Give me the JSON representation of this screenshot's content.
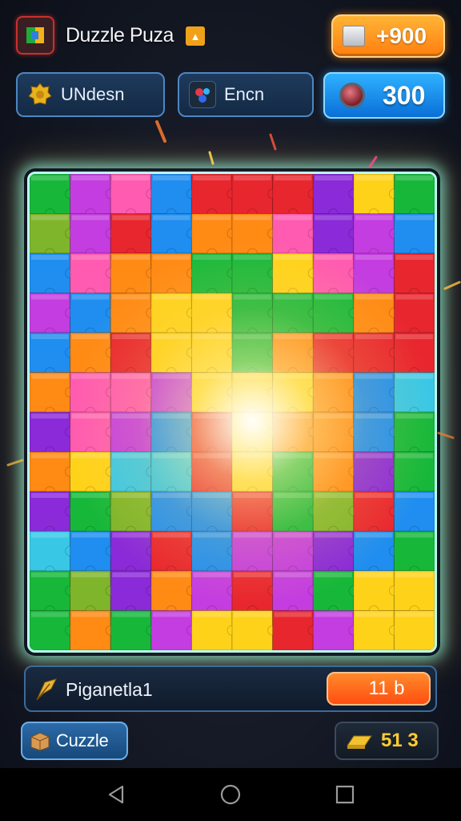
{
  "header": {
    "title": "Duzzle Puza",
    "title_badge": "▲",
    "coins": "+900"
  },
  "actions": {
    "unlock_label": "UNdesn",
    "enchant_label": "Encn",
    "score": "300"
  },
  "board": {
    "cols": 10,
    "rows": 12,
    "palette": [
      "#17b83a",
      "#c43de0",
      "#ff8a14",
      "#1f8ef0",
      "#ffd21a",
      "#e8262e",
      "#8a2ad8",
      "#39c7e6",
      "#7fb52a",
      "#ff5bb0"
    ],
    "tiles": [
      [
        0,
        1,
        9,
        3,
        5,
        5,
        5,
        6,
        4,
        0
      ],
      [
        8,
        1,
        5,
        3,
        2,
        2,
        9,
        6,
        1,
        3
      ],
      [
        3,
        9,
        2,
        2,
        0,
        0,
        4,
        9,
        1,
        5
      ],
      [
        1,
        3,
        2,
        4,
        4,
        0,
        0,
        0,
        2,
        5
      ],
      [
        3,
        2,
        5,
        4,
        4,
        0,
        2,
        5,
        5,
        5
      ],
      [
        2,
        9,
        9,
        1,
        4,
        4,
        4,
        2,
        3,
        7
      ],
      [
        6,
        9,
        1,
        3,
        5,
        4,
        2,
        2,
        3,
        0
      ],
      [
        2,
        4,
        7,
        7,
        5,
        4,
        0,
        2,
        6,
        0
      ],
      [
        6,
        0,
        8,
        3,
        3,
        5,
        0,
        8,
        5,
        3
      ],
      [
        7,
        3,
        6,
        5,
        3,
        1,
        1,
        6,
        3,
        0
      ],
      [
        0,
        8,
        6,
        2,
        1,
        5,
        1,
        0,
        4,
        4
      ],
      [
        0,
        2,
        0,
        1,
        4,
        4,
        5,
        1,
        4,
        4
      ]
    ]
  },
  "footer": {
    "info_label": "Piganetla1",
    "level_value": "11 b",
    "puzzle_label": "Cuzzle",
    "gold_value": "51 3"
  },
  "colors": {
    "accent_orange": "#ff8a14",
    "accent_blue": "#1f8ef0",
    "board_glow": "#b8fff0"
  },
  "icons": {
    "app": "puzzle-app-icon",
    "coin": "silver-block-icon",
    "unlock": "gold-gear-icon",
    "enchant": "gem-cluster-icon",
    "score": "red-orb-icon",
    "info": "feather-icon",
    "puzzle": "box-icon",
    "gold": "gold-bar-icon"
  }
}
